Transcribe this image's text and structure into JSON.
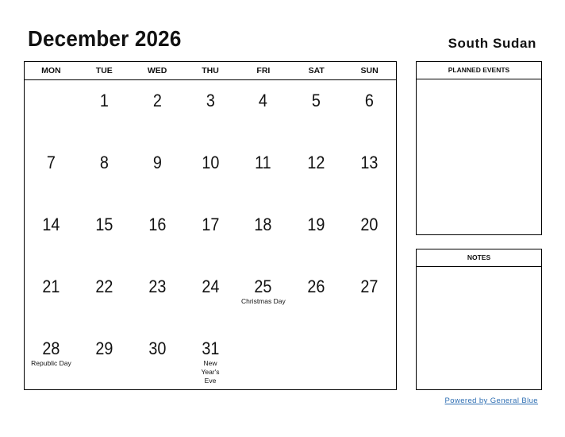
{
  "header": {
    "title": "December 2026",
    "country": "South Sudan"
  },
  "calendar": {
    "weekdays": [
      "MON",
      "TUE",
      "WED",
      "THU",
      "FRI",
      "SAT",
      "SUN"
    ],
    "cells": [
      {
        "day": "",
        "event": ""
      },
      {
        "day": "1",
        "event": ""
      },
      {
        "day": "2",
        "event": ""
      },
      {
        "day": "3",
        "event": ""
      },
      {
        "day": "4",
        "event": ""
      },
      {
        "day": "5",
        "event": ""
      },
      {
        "day": "6",
        "event": ""
      },
      {
        "day": "7",
        "event": ""
      },
      {
        "day": "8",
        "event": ""
      },
      {
        "day": "9",
        "event": ""
      },
      {
        "day": "10",
        "event": ""
      },
      {
        "day": "11",
        "event": ""
      },
      {
        "day": "12",
        "event": ""
      },
      {
        "day": "13",
        "event": ""
      },
      {
        "day": "14",
        "event": ""
      },
      {
        "day": "15",
        "event": ""
      },
      {
        "day": "16",
        "event": ""
      },
      {
        "day": "17",
        "event": ""
      },
      {
        "day": "18",
        "event": ""
      },
      {
        "day": "19",
        "event": ""
      },
      {
        "day": "20",
        "event": ""
      },
      {
        "day": "21",
        "event": ""
      },
      {
        "day": "22",
        "event": ""
      },
      {
        "day": "23",
        "event": ""
      },
      {
        "day": "24",
        "event": ""
      },
      {
        "day": "25",
        "event": "Christmas Day"
      },
      {
        "day": "26",
        "event": ""
      },
      {
        "day": "27",
        "event": ""
      },
      {
        "day": "28",
        "event": "Republic Day"
      },
      {
        "day": "29",
        "event": ""
      },
      {
        "day": "30",
        "event": ""
      },
      {
        "day": "31",
        "event": "New Year's Eve"
      },
      {
        "day": "",
        "event": ""
      },
      {
        "day": "",
        "event": ""
      },
      {
        "day": "",
        "event": ""
      }
    ]
  },
  "panels": {
    "planned_events": "PLANNED EVENTS",
    "notes": "NOTES"
  },
  "footer": {
    "link_text": "Powered by General Blue",
    "link_color": "#2f6fb3"
  }
}
